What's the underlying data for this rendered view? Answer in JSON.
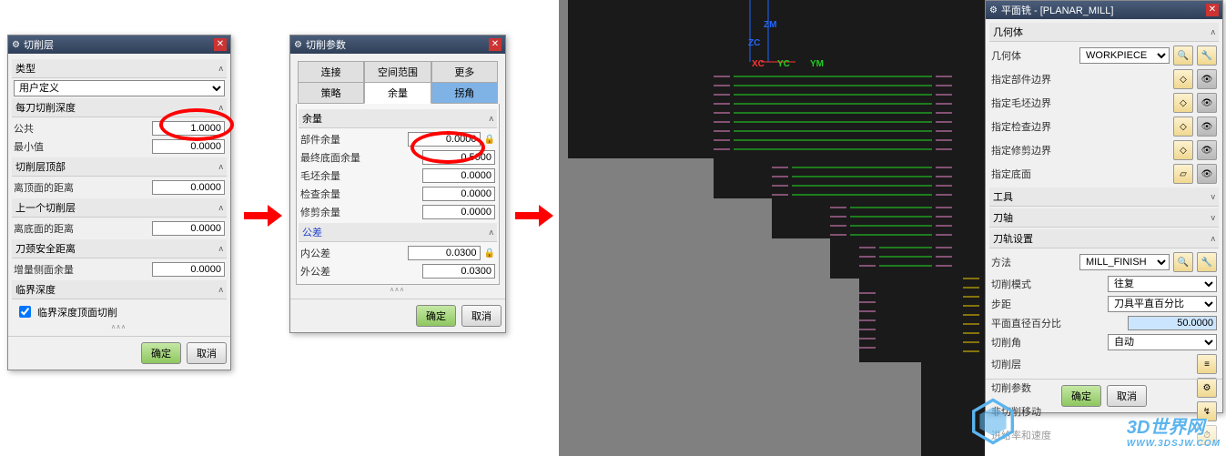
{
  "panel1": {
    "title": "切削层",
    "sec_type": "类型",
    "type_value": "用户定义",
    "sec_depth": "每刀切削深度",
    "common_label": "公共",
    "common_val": "1.0000",
    "min_label": "最小值",
    "min_val": "0.0000",
    "sec_top": "切削层顶部",
    "topdist_label": "离顶面的距离",
    "topdist_val": "0.0000",
    "sec_prev": "上一个切削层",
    "botdist_label": "离底面的距离",
    "botdist_val": "0.0000",
    "sec_neck": "刀颈安全距离",
    "sidemargin_label": "增量侧面余量",
    "sidemargin_val": "0.0000",
    "sec_crit": "临界深度",
    "crit_chk": "临界深度顶面切削"
  },
  "panel2": {
    "title": "切削参数",
    "tab_conn": "连接",
    "tab_space": "空间范围",
    "tab_more": "更多",
    "tab_strategy": "策略",
    "tab_margin": "余量",
    "tab_corner": "拐角",
    "sec_margin": "余量",
    "part_label": "部件余量",
    "part_val": "0.0000",
    "final_label": "最终底面余量",
    "final_val": "0.5000",
    "blank_label": "毛坯余量",
    "blank_val": "0.0000",
    "check_label": "检查余量",
    "check_val": "0.0000",
    "trim_label": "修剪余量",
    "trim_val": "0.0000",
    "sec_tol": "公差",
    "intol_label": "内公差",
    "intol_val": "0.0300",
    "outtol_label": "外公差",
    "outtol_val": "0.0300"
  },
  "panel3": {
    "title": "平面铣 - [PLANAR_MILL]",
    "sec_geom": "几何体",
    "geom_label": "几何体",
    "geom_val": "WORKPIECE",
    "partb_label": "指定部件边界",
    "blankb_label": "指定毛坯边界",
    "checkb_label": "指定检查边界",
    "trimb_label": "指定修剪边界",
    "floor_label": "指定底面",
    "sec_tool": "工具",
    "sec_axis": "刀轴",
    "sec_path": "刀轨设置",
    "method_label": "方法",
    "method_val": "MILL_FINISH",
    "cutmode_label": "切削模式",
    "cutmode_val": "往复",
    "step_label": "步距",
    "step_val": "刀具平直百分比",
    "diam_label": "平面直径百分比",
    "diam_val": "50.0000",
    "cutangle_label": "切削角",
    "cutangle_val": "自动",
    "cutlayer_label": "切削层",
    "cutparam_label": "切削参数",
    "noncut_label": "非切削移动",
    "feed_label": "进给率和速度"
  },
  "btn": {
    "ok": "确定",
    "cancel": "取消"
  },
  "axis": {
    "zm": "ZM",
    "zc": "ZC",
    "xc": "XC",
    "yc": "YC",
    "ym": "YM"
  },
  "watermark": {
    "main": "3D世界网",
    "url": "WWW.3DSJW.COM"
  }
}
